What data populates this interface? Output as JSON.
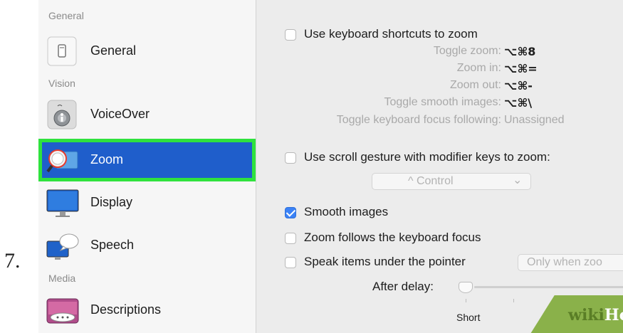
{
  "step_number": "7.",
  "sidebar": {
    "sections": {
      "general": "General",
      "vision": "Vision",
      "media": "Media"
    },
    "items": [
      {
        "label": "General",
        "icon": "general-icon"
      },
      {
        "label": "VoiceOver",
        "icon": "voiceover-icon"
      },
      {
        "label": "Zoom",
        "icon": "zoom-icon",
        "selected": true
      },
      {
        "label": "Display",
        "icon": "display-icon"
      },
      {
        "label": "Speech",
        "icon": "speech-icon"
      },
      {
        "label": "Descriptions",
        "icon": "descriptions-icon"
      }
    ]
  },
  "zoom_panel": {
    "keyboard_shortcuts": {
      "label": "Use keyboard shortcuts to zoom",
      "checked": false,
      "shortcuts": [
        {
          "label": "Toggle zoom:",
          "value": "⌥⌘8"
        },
        {
          "label": "Zoom in:",
          "value": "⌥⌘="
        },
        {
          "label": "Zoom out:",
          "value": "⌥⌘-"
        },
        {
          "label": "Toggle smooth images:",
          "value": "⌥⌘\\"
        },
        {
          "label": "Toggle keyboard focus following:",
          "value": "Unassigned"
        }
      ]
    },
    "scroll_gesture": {
      "label": "Use scroll gesture with modifier keys to zoom:",
      "checked": false,
      "modifier": "^ Control",
      "chevron": "⌄"
    },
    "smooth_images": {
      "label": "Smooth images",
      "checked": true
    },
    "follow_focus": {
      "label": "Zoom follows the keyboard focus",
      "checked": false
    },
    "speak_items": {
      "label": "Speak items under the pointer",
      "checked": false,
      "mode": "Only when zoo"
    },
    "delay": {
      "label": "After delay:",
      "min_label": "Short",
      "value": 0
    }
  },
  "watermark": {
    "part1": "wiki",
    "part2": "How"
  },
  "colors": {
    "selection": "#1f5ecb",
    "highlight_border": "#2fe23e",
    "checkbox_checked": "#3b82f6",
    "watermark_green": "#8ab14a"
  }
}
